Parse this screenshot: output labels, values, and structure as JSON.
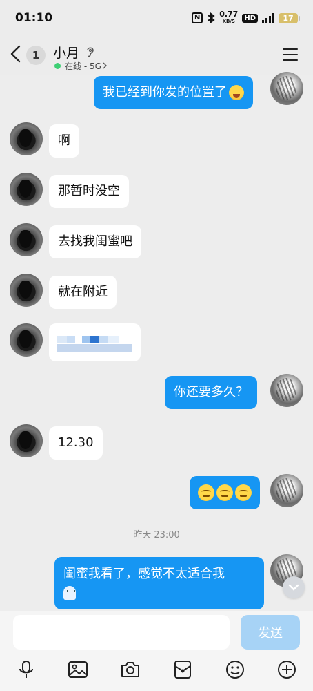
{
  "status_bar": {
    "time": "01:10",
    "nfc": "N",
    "net_speed_value": "0.77",
    "net_speed_unit": "KB/S",
    "hd": "HD",
    "signal_label": "5G",
    "battery": "17"
  },
  "header": {
    "unread_count": "1",
    "contact_name": "小月",
    "online_status": "在线 - 5G"
  },
  "messages": [
    {
      "side": "me",
      "text": "我已经到你发的位置了",
      "emoji": "laughing-face"
    },
    {
      "side": "them",
      "text": "啊"
    },
    {
      "side": "them",
      "text": "那暂时没空"
    },
    {
      "side": "them",
      "text": "去找我闺蜜吧"
    },
    {
      "side": "them",
      "text": "就在附近"
    },
    {
      "side": "them",
      "text": "",
      "note": "pixelated image"
    },
    {
      "side": "me",
      "text": "你还要多久？"
    },
    {
      "side": "them",
      "text": "12.30"
    },
    {
      "side": "me",
      "text": "",
      "emoji": "squinting-tongue-face x3"
    },
    {
      "side": "me",
      "text": "闺蜜我看了，感觉不太适合我",
      "emoji": "ghost"
    }
  ],
  "timestamp": "昨天 23:00",
  "composer": {
    "placeholder": "",
    "send_label": "发送"
  },
  "toolbar": [
    "mic-icon",
    "gallery-icon",
    "camera-icon",
    "red-packet-icon",
    "emoji-icon",
    "plus-icon"
  ],
  "colors": {
    "my_bubble": "#1696f3",
    "their_bubble": "#ffffff",
    "background": "#ededed",
    "send_button_disabled": "#a7d3f6",
    "online_dot": "#3ecf74"
  }
}
